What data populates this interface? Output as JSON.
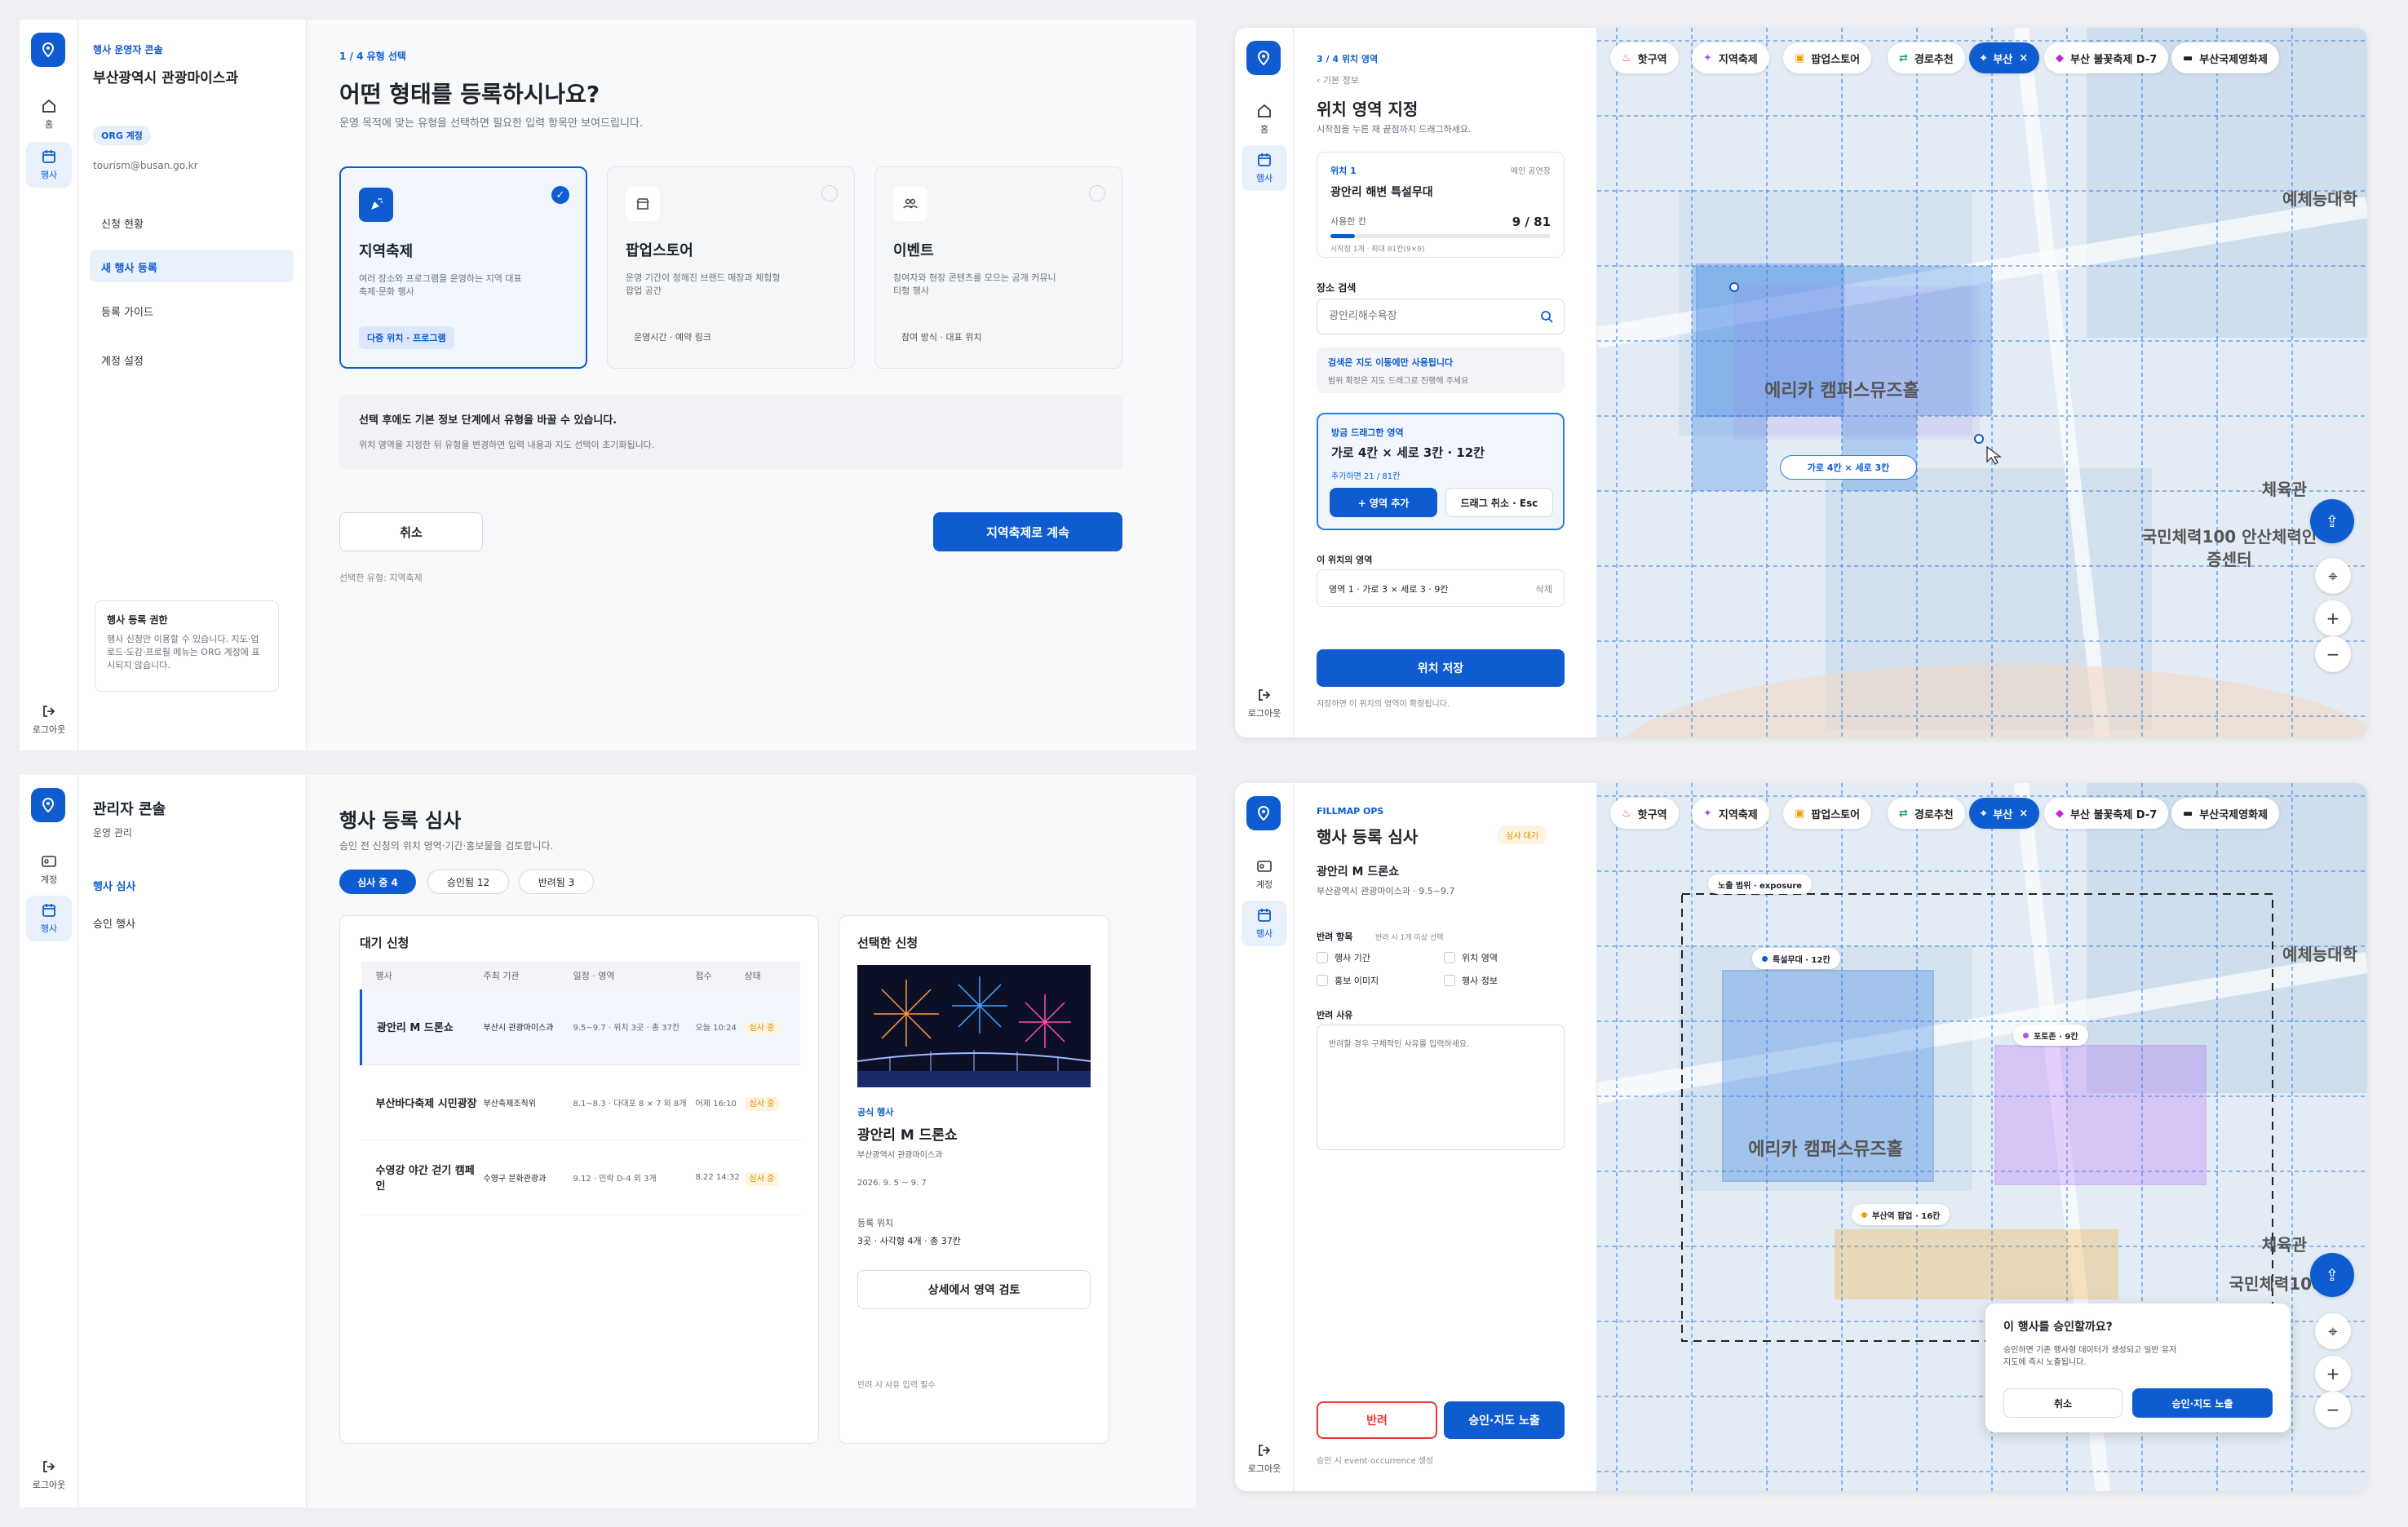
{
  "q1": {
    "rail": {
      "home": "홈",
      "event": "행사",
      "logout": "로그아웃"
    },
    "nav": {
      "org_label": "행사 운영자 콘솔",
      "org_name": "부산광역시 관광마이스과",
      "badge": "ORG 계정",
      "email": "tourism@busan.go.kr",
      "items": [
        "신청 현황",
        "새 행사 등록",
        "등록 가이드",
        "계정 설정"
      ],
      "notice_title": "행사 등록 권한",
      "notice_body": "행사 신청만 이용할 수 있습니다. 지도·업로드·도감·프로필 메뉴는 ORG 계정에 표시되지 않습니다."
    },
    "step": "1 / 4  유형 선택",
    "title": "어떤 형태를 등록하시나요?",
    "subtitle": "운영 목적에 맞는 유형을 선택하면 필요한 입력 항목만 보여드립니다.",
    "types": [
      {
        "name": "지역축제",
        "desc": "여러 장소와 프로그램을 운영하는 지역 대표 축제·문화 행사",
        "tag": "다중 위치 · 프로그램",
        "icon": "party-icon"
      },
      {
        "name": "팝업스토어",
        "desc": "운영 기간이 정해진 브랜드 매장과 체험형 팝업 공간",
        "tag": "운영시간 · 예약 링크",
        "icon": "store-icon"
      },
      {
        "name": "이벤트",
        "desc": "참여자와 현장 콘텐츠를 모으는 공개 커뮤니티형 행사",
        "tag": "참여 방식 · 대표 위치",
        "icon": "people-icon"
      }
    ],
    "info_title": "선택 후에도 기본 정보 단계에서 유형을 바꿀 수 있습니다.",
    "info_body": "위치 영역을 지정한 뒤 유형을 변경하면 입력 내용과 지도 선택이 초기화됩니다.",
    "cancel": "취소",
    "next": "지역축제로 계속",
    "selected": "선택한 유형: 지역축제"
  },
  "map_chips": [
    "핫구역",
    "지역축제",
    "팝업스토어",
    "경로추천",
    "부산",
    "부산 불꽃축제 D-7",
    "부산국제영화제"
  ],
  "map_labels": {
    "a": "예체능대학",
    "b": "에리카 캠퍼스뮤즈홀",
    "c": "체육관",
    "d": "국민체력100 안산체력인증센터",
    "d2": "국민체력100"
  },
  "q2": {
    "step": "3 / 4  위치 영역",
    "back": "‹ 기본 정보",
    "title": "위치 영역 지정",
    "subtitle": "시작점을 누른 채 끝점까지 드래그하세요.",
    "loc_label": "위치 1",
    "loc_tag": "메인 공연장",
    "loc_name": "광안리 해변 특설무대",
    "used_label": "사용한 칸",
    "used_value": "9 / 81",
    "used_note": "시작점 1개 · 최대 81칸(9×9)",
    "search_label": "장소 검색",
    "search_placeholder": "광안리해수욕장",
    "warn_title": "검색은 지도 이동에만 사용됩니다",
    "warn_body": "범위 확정은 지도 드래그로 진행해 주세요",
    "drag_label": "방금 드래그한 영역",
    "drag_value": "가로 4칸 × 세로 3칸 · 12칸",
    "drag_note": "추가하면 21 / 81칸",
    "add": "+ 영역 추가",
    "cancel": "드래그 취소 · Esc",
    "areas_label": "이 위치의 영역",
    "area_item": "영역 1 · 가로 3 × 세로 3 · 9칸",
    "delete": "삭제",
    "save": "위치 저장",
    "save_note": "저장하면 이 위치의 영역이 확정됩니다.",
    "rail": {
      "home": "홈",
      "event": "행사",
      "logout": "로그아웃"
    },
    "map_tip": "가로 4칸 × 세로 3칸"
  },
  "q3": {
    "rail": {
      "account": "계정",
      "event": "행사",
      "logout": "로그아웃"
    },
    "nav": {
      "title": "관리자 콘솔",
      "sub": "운영 관리",
      "items": [
        "행사 심사",
        "승인 행사"
      ]
    },
    "title": "행사 등록 심사",
    "subtitle": "승인 전 신청의 위치 영역·기간·홍보물을 검토합니다.",
    "tabs": [
      "심사 중 4",
      "승인됨 12",
      "반려됨 3"
    ],
    "list_title": "대기 신청",
    "cols": [
      "행사",
      "주최 기관",
      "일정 · 영역",
      "접수",
      "상태"
    ],
    "rows": [
      {
        "name": "광안리 M 드론쇼",
        "org": "부산시 관광마이스과",
        "sched": "9.5~9.7 · 위치 3곳 · 총 37칸",
        "time": "오늘 10:24",
        "status": "심사 중"
      },
      {
        "name": "부산바다축제 시민광장",
        "org": "부산축제조직위",
        "sched": "8.1~8.3 · 다대포 8 × 7 외 8개",
        "time": "어제 16:10",
        "status": "심사 중"
      },
      {
        "name": "수영강 야간 걷기 캠페인",
        "org": "수영구 문화관광과",
        "sched": "9.12 · 민락 D-4 외 3개",
        "time": "8.22 14:32",
        "status": "심사 중"
      }
    ],
    "detail_title": "선택한 신청",
    "official": "공식 행사",
    "d_name": "광안리 M 드론쇼",
    "d_org": "부산광역시 관광마이스과",
    "d_date": "2026. 9. 5 ~ 9. 7",
    "d_loc_label": "등록 위치",
    "d_loc": "3곳 · 사각형 4개 · 총 37칸",
    "d_btn": "상세에서 영역 검토",
    "d_note": "반려 시 사유 입력 필수"
  },
  "q4": {
    "rail": {
      "account": "계정",
      "event": "행사",
      "logout": "로그아웃"
    },
    "brand": "FILLMAP OPS",
    "title": "행사 등록 심사",
    "status": "심사 대기",
    "name": "광안리 M 드론쇼",
    "sub": "부산광역시 관광마이스과 · 9.5~9.7",
    "reject_label": "반려 항목",
    "reject_hint": "반려 시 1개 이상 선택",
    "checks": [
      "행사 기간",
      "위치 영역",
      "홍보 이미지",
      "행사 정보"
    ],
    "reason_label": "반려 사유",
    "reason_placeholder": "반려할 경우 구체적인 사유를 입력하세요.",
    "reject": "반려",
    "approve": "승인·지도 노출",
    "note": "승인 시 event-occurrence 생성",
    "exposure": "노출 범위 · exposure",
    "z1": "특설무대 · 12칸",
    "z2": "포토존 · 9칸",
    "z3": "부산역 팝업 · 16칸",
    "dlg_title": "이 행사를 승인할까요?",
    "dlg_body": "승인하면 기존 행사형 데이터가 생성되고 일반 유저 지도에 즉시 노출됩니다.",
    "dlg_cancel": "취소",
    "dlg_ok": "승인·지도 노출"
  }
}
